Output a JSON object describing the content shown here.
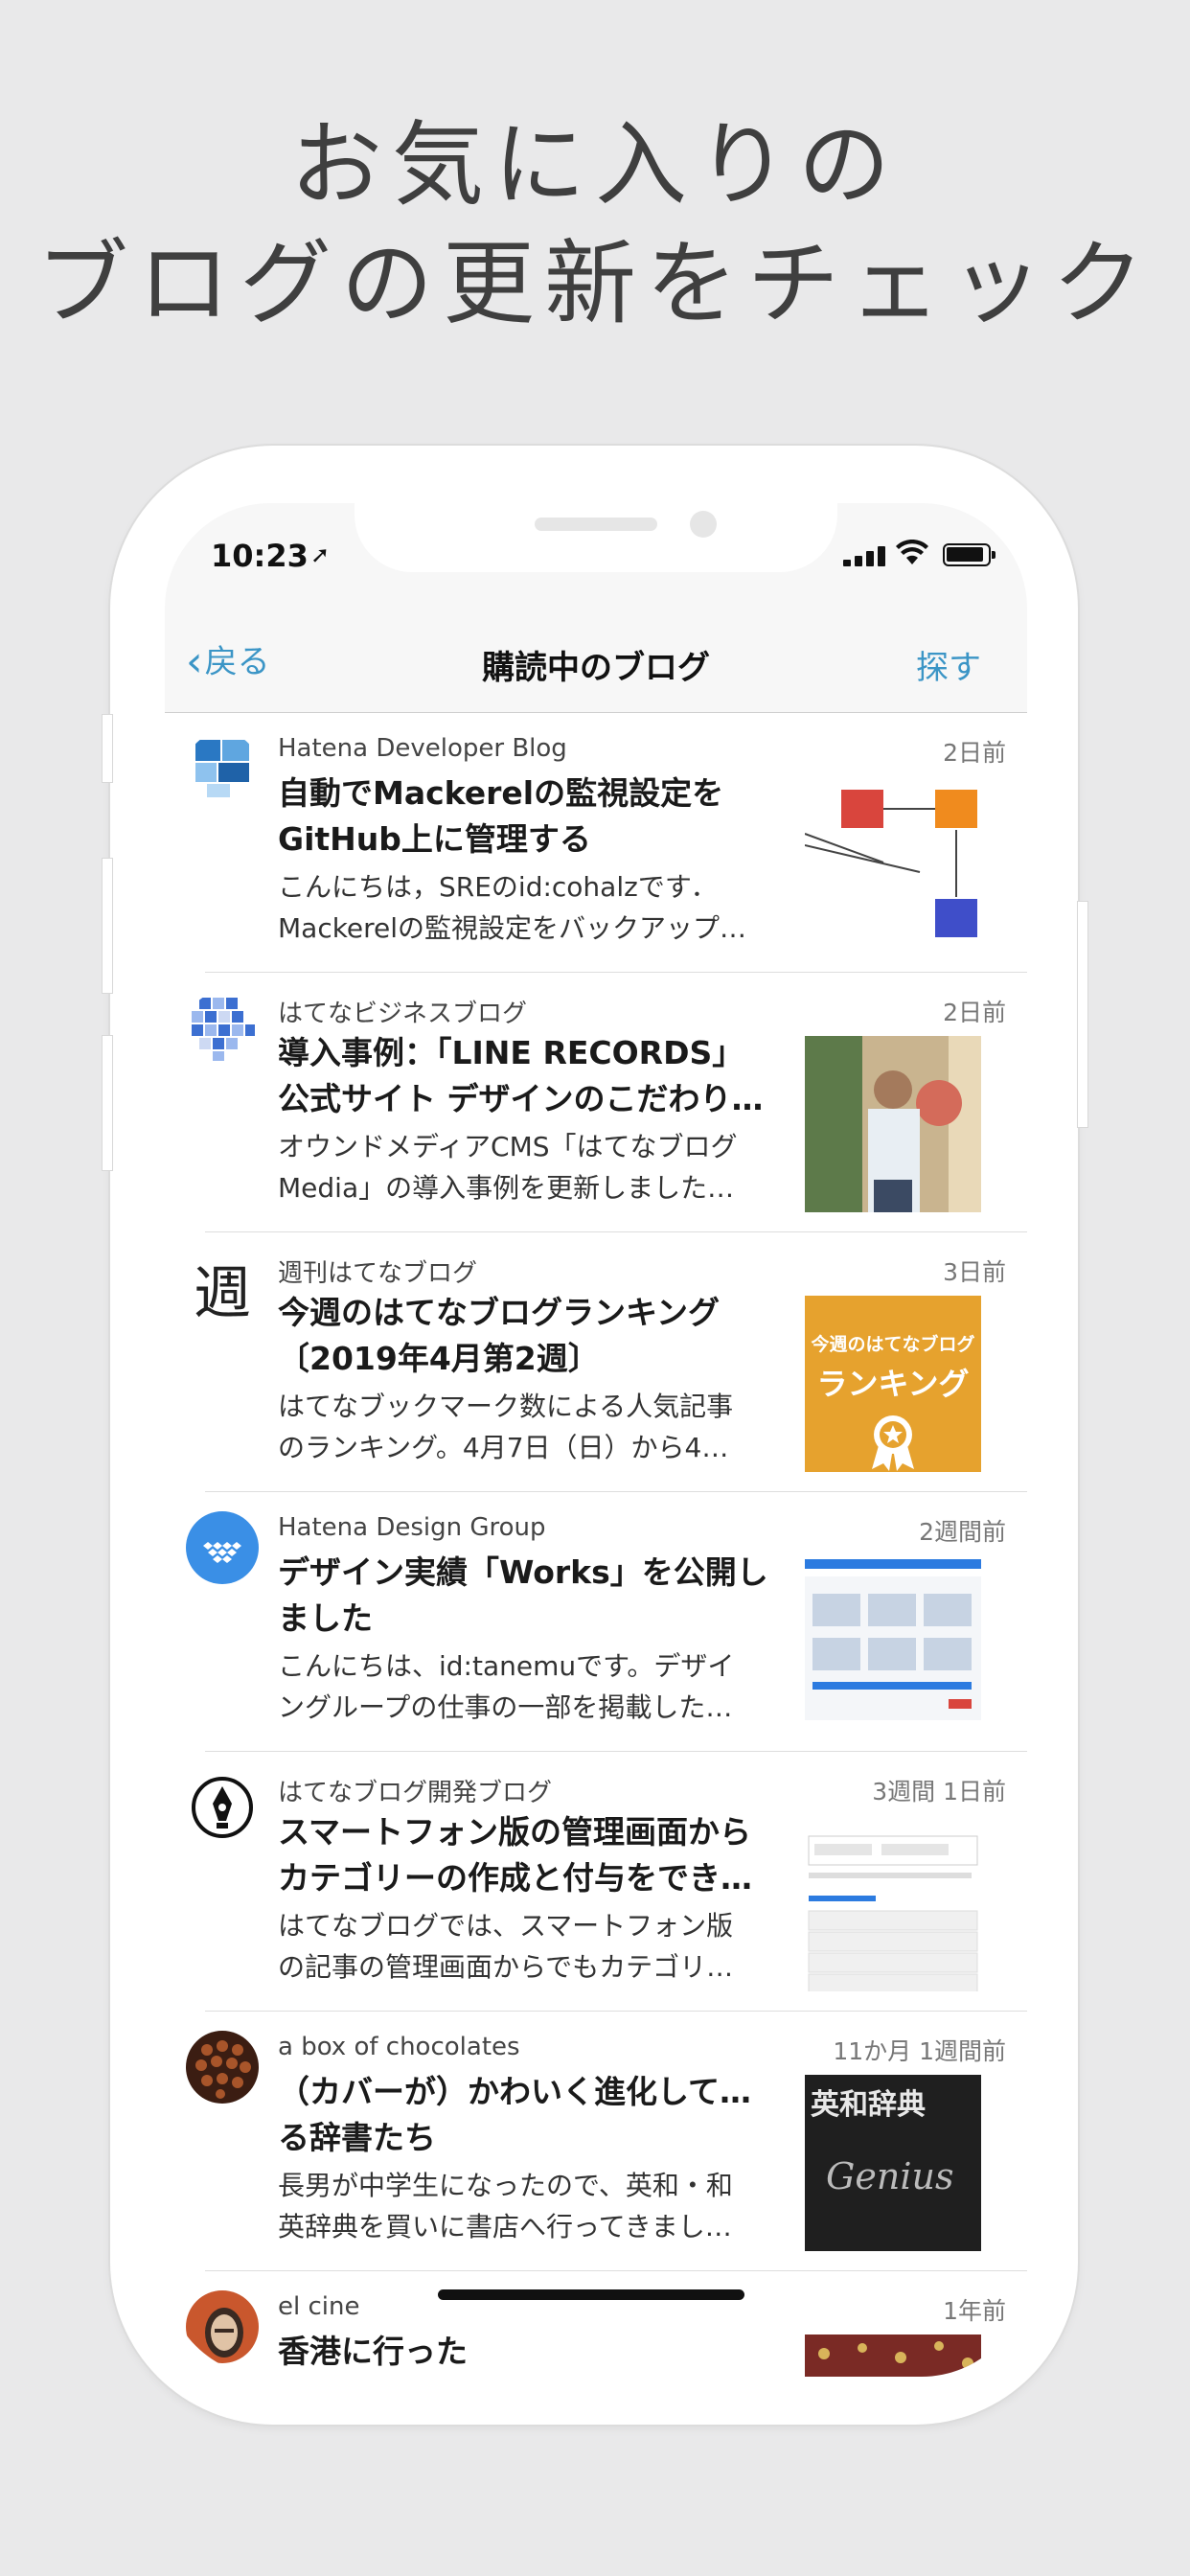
{
  "promo": {
    "line1": "お気に入りの",
    "line2": "ブログの更新をチェック"
  },
  "status": {
    "time": "10:23",
    "location_icon": "location-arrow-icon"
  },
  "nav": {
    "back_label": "戻る",
    "title": "購読中のブログ",
    "search_label": "探す"
  },
  "items": [
    {
      "blog": "Hatena Developer Blog",
      "date": "2日前",
      "title": [
        "自動でMackerelの監視設定を",
        "GitHub上に管理する"
      ],
      "excerpt": [
        "こんにちは，SREのid:cohalzです．",
        "Mackerelの監視設定をバックアップ…"
      ]
    },
    {
      "blog": "はてなビジネスブログ",
      "date": "2日前",
      "title": [
        "導入事例：「LINE RECORDS」",
        "公式サイト デザインのこだわり…"
      ],
      "excerpt": [
        "オウンドメディアCMS「はてなブログ",
        "Media」の導入事例を更新しました…"
      ]
    },
    {
      "blog": "週刊はてなブログ",
      "date": "3日前",
      "title": [
        "今週のはてなブログランキング",
        "〔2019年4月第2週〕"
      ],
      "excerpt": [
        "はてなブックマーク数による人気記事",
        "のランキング。4月7日（日）から4…"
      ],
      "avatar_text": "週",
      "thumb_text": [
        "今週のはてなブログ",
        "ランキング"
      ]
    },
    {
      "blog": "Hatena Design Group",
      "date": "2週間前",
      "title": [
        "デザイン実績「Works」を公開し",
        "ました"
      ],
      "excerpt": [
        "こんにちは、id:tanemuです。デザイ",
        "ングループの仕事の一部を掲載した…"
      ]
    },
    {
      "blog": "はてなブログ開発ブログ",
      "date": "3週間 1日前",
      "title": [
        "スマートフォン版の管理画面から",
        "カテゴリーの作成と付与をでき…"
      ],
      "excerpt": [
        "はてなブログでは、スマートフォン版",
        "の記事の管理画面からでもカテゴリ…"
      ]
    },
    {
      "blog": "a box of chocolates",
      "date": "11か月 1週間前",
      "title": [
        "（カバーが）かわいく進化している",
        "る辞書たち"
      ],
      "excerpt": [
        "長男が中学生になったので、英和・和",
        "英辞典を買いに書店へ行ってきまし…"
      ],
      "thumb_text": [
        "英和辞典",
        "Genius"
      ]
    },
    {
      "blog": "el cine",
      "date": "1年前",
      "title": [
        "香港に行った"
      ],
      "excerpt": []
    }
  ]
}
